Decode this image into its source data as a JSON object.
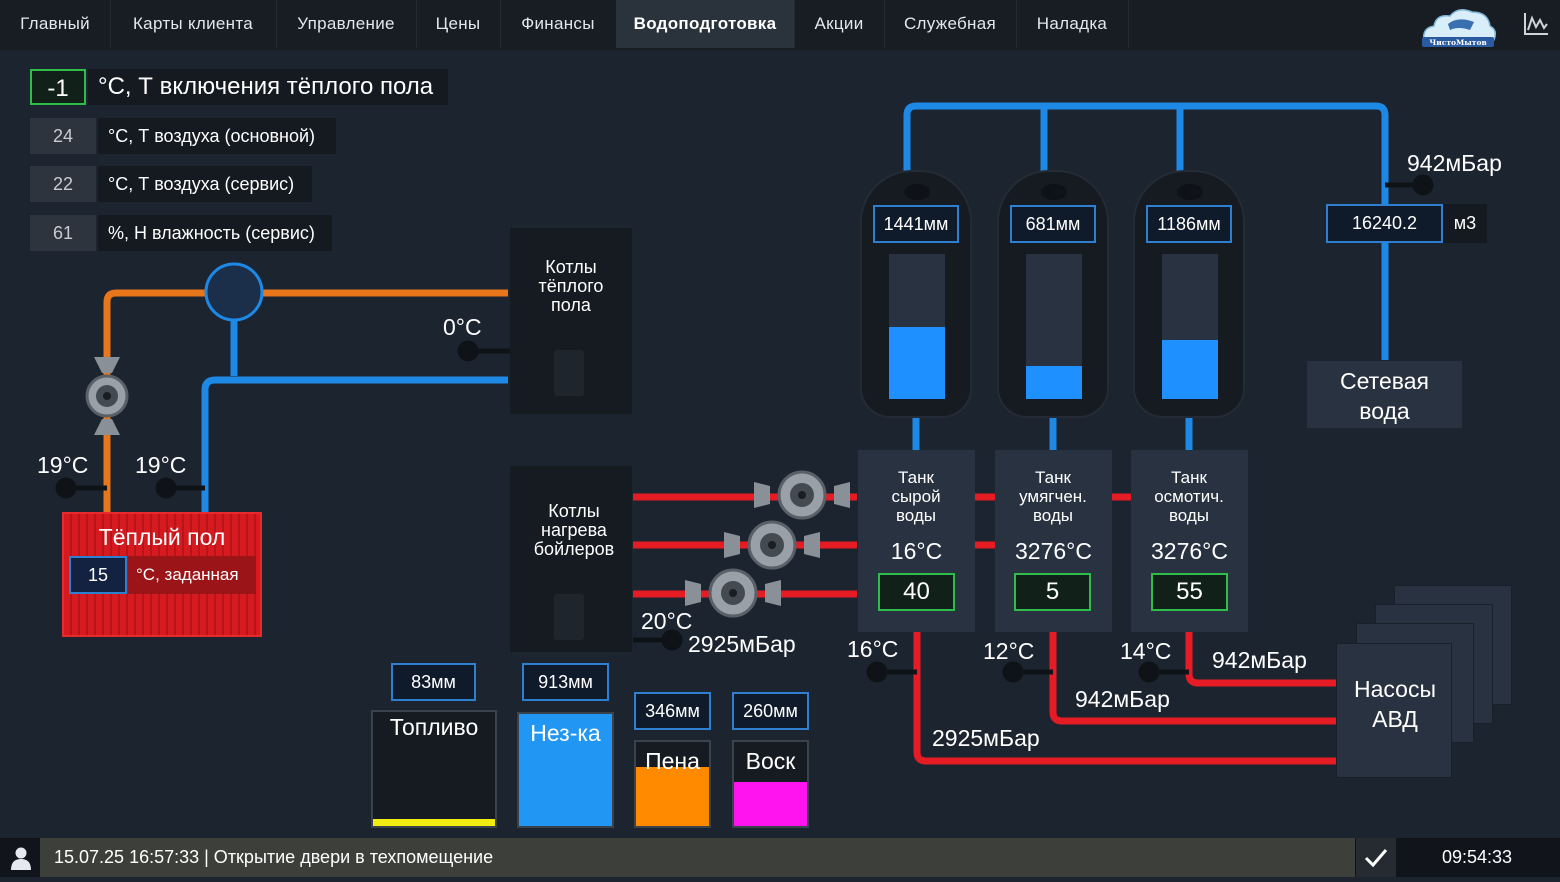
{
  "nav": {
    "tabs": [
      "Главный",
      "Карты клиента",
      "Управление",
      "Цены",
      "Финансы",
      "Водоподготовка",
      "Акции",
      "Служебная",
      "Наладка"
    ],
    "active_tab": "Водоподготовка",
    "logo_text": "ЧистоМытов"
  },
  "params": {
    "floor_on_temp": {
      "value": "-1",
      "label": "°C, Т включения тёплого пола"
    },
    "air_main": {
      "value": "24",
      "label": "°C, Т воздуха (основной)"
    },
    "air_service": {
      "value": "22",
      "label": "°C, Т воздуха (сервис)"
    },
    "humidity_service": {
      "value": "61",
      "label": "%, Н влажность (сервис)"
    }
  },
  "heating": {
    "temp_left": "19°C",
    "temp_right": "19°C",
    "floor_title": "Тёплый пол",
    "floor_setpoint": "15",
    "floor_setpoint_label": "°C, заданная",
    "boiler_floor_title": "Котлы тёплого пола",
    "boiler_floor_temp": "0°C",
    "boiler_water_title": "Котлы нагрева бойлеров",
    "boiler_water_temp": "20°C",
    "boiler_water_pressure": "2925мБар"
  },
  "tanks": [
    {
      "level_label": "1441мм",
      "fill": 0.5,
      "name": "Танк сырой воды",
      "temp": "16°C",
      "value": "40",
      "pipe_temp": "16°C"
    },
    {
      "level_label": "681мм",
      "fill": 0.23,
      "name": "Танк умягчен. воды",
      "temp": "3276°C",
      "value": "5",
      "pipe_temp": "12°C"
    },
    {
      "level_label": "1186мм",
      "fill": 0.41,
      "name": "Танк осмотич. воды",
      "temp": "3276°C",
      "value": "55",
      "pipe_temp": "14°C"
    }
  ],
  "network_water": {
    "title": "Сетевая вода",
    "pressure": "942мБар",
    "volume": "16240.2",
    "unit": "м3"
  },
  "avd": {
    "title": "Насосы АВД",
    "pressure_1": "942мБар",
    "pressure_2": "942мБар",
    "pressure_3": "2925мБар"
  },
  "chem": [
    {
      "name": "Топливо",
      "level": "83мм",
      "fill": 0.06,
      "color": "#f3ec12"
    },
    {
      "name": "Нез-ка",
      "level": "913мм",
      "fill": 1.0,
      "color": "#2196f3"
    },
    {
      "name": "Пена",
      "level": "346мм",
      "fill": 0.7,
      "color": "#ff8a00"
    },
    {
      "name": "Воск",
      "level": "260мм",
      "fill": 0.52,
      "color": "#ff14f0"
    }
  ],
  "colors": {
    "hot": "#e51c23",
    "cold": "#1e88e5",
    "orange": "#e8761a",
    "ok": "#2fbd49"
  },
  "footer": {
    "message": "15.07.25 16:57:33 | Открытие двери в техпомещение",
    "time": "09:54:33"
  }
}
